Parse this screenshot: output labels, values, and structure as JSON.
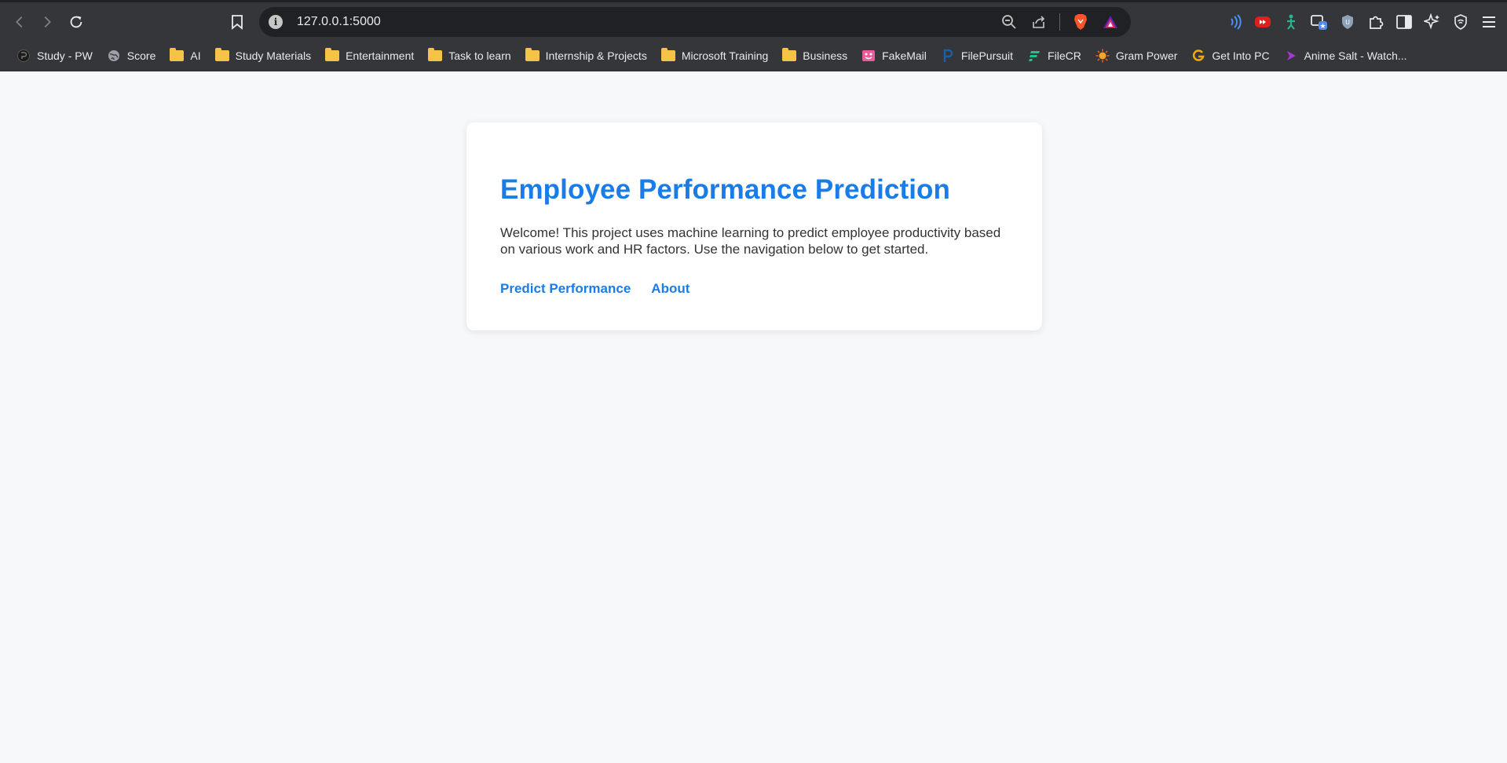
{
  "browser": {
    "url": "127.0.0.1:5000",
    "bookmarks": [
      {
        "label": "Study - PW",
        "icon": "pw-logo-icon"
      },
      {
        "label": "Score",
        "icon": "globe-icon"
      },
      {
        "label": "AI",
        "icon": "folder-icon"
      },
      {
        "label": "Study Materials",
        "icon": "folder-icon"
      },
      {
        "label": "Entertainment",
        "icon": "folder-icon"
      },
      {
        "label": "Task to learn",
        "icon": "folder-icon"
      },
      {
        "label": "Internship & Projects",
        "icon": "folder-icon"
      },
      {
        "label": "Microsoft Training",
        "icon": "folder-icon"
      },
      {
        "label": "Business",
        "icon": "folder-icon"
      },
      {
        "label": "FakeMail",
        "icon": "fakemail-icon"
      },
      {
        "label": "FilePursuit",
        "icon": "filepursuit-icon"
      },
      {
        "label": "FileCR",
        "icon": "filecr-icon"
      },
      {
        "label": "Gram Power",
        "icon": "gram-power-icon"
      },
      {
        "label": "Get Into PC",
        "icon": "get-into-pc-icon"
      },
      {
        "label": "Anime Salt - Watch...",
        "icon": "anime-salt-icon"
      }
    ]
  },
  "page": {
    "title": "Employee Performance Prediction",
    "description": "Welcome! This project uses machine learning to predict employee productivity based on various work and HR factors. Use the navigation below to get started.",
    "links": {
      "predict": "Predict Performance",
      "about": "About"
    }
  },
  "colors": {
    "accent": "#1a7ce6",
    "page_bg": "#f7f8fa",
    "chrome_bg": "#35363a"
  }
}
